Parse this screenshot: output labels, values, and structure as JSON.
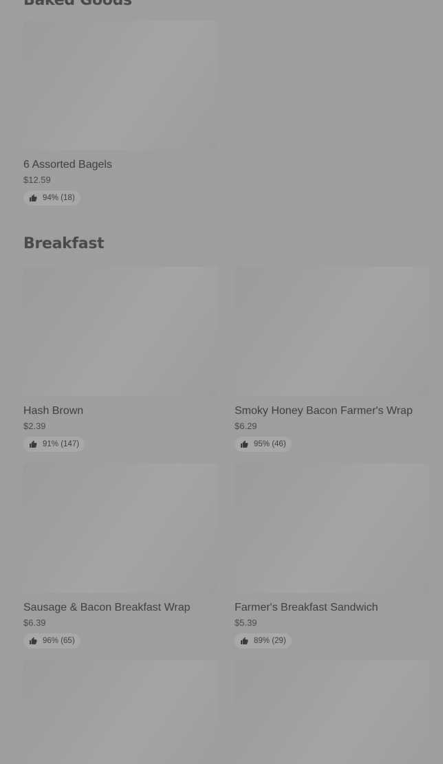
{
  "sections": [
    {
      "title": "Baked Goods",
      "items": [
        {
          "name": "6 Assorted Bagels",
          "price": "$12.59",
          "rating": "94% (18)"
        }
      ]
    },
    {
      "title": "Breakfast",
      "items": [
        {
          "name": "Hash Brown",
          "price": "$2.39",
          "rating": "91% (147)"
        },
        {
          "name": "Smoky Honey Bacon Farmer's Wrap",
          "price": "$6.29",
          "rating": "95% (46)"
        },
        {
          "name": "Sausage & Bacon Breakfast Wrap",
          "price": "$6.39",
          "rating": "96% (65)"
        },
        {
          "name": "Farmer's Breakfast Sandwich",
          "price": "$5.39",
          "rating": "89% (29)"
        }
      ]
    }
  ],
  "icons": {
    "rating": "thumbs-up-icon"
  }
}
